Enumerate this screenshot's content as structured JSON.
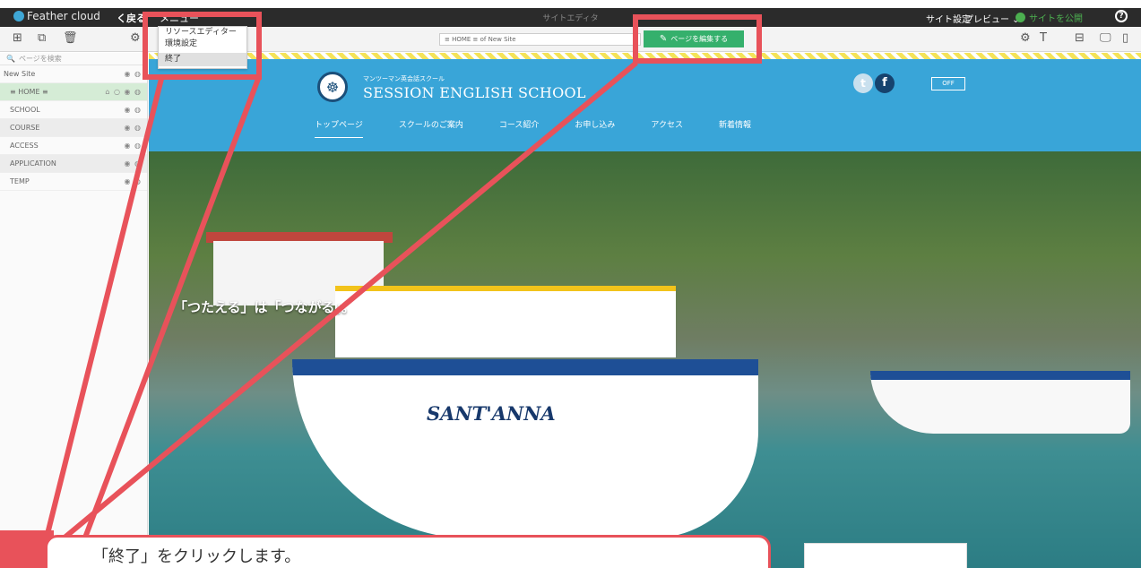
{
  "app": {
    "brand": "Feather cloud",
    "back_label": "く戻る",
    "menu_label": "メニュー",
    "title": "サイトエディタ",
    "site_settings": "サイト設定",
    "preview": "プレビュー ⌄",
    "publish": "サイトを公開",
    "help": "?"
  },
  "menu": {
    "items": [
      "リソースエディター",
      "環境設定",
      "終了"
    ]
  },
  "toolbar": {
    "url": "≡ HOME ≡ of New Site",
    "edit_button": "ページを編集する"
  },
  "sidebar": {
    "search_placeholder": "ページを検索",
    "items": [
      {
        "label": "New Site",
        "state": "root"
      },
      {
        "label": "≡ HOME ≡",
        "state": "selected"
      },
      {
        "label": "SCHOOL",
        "state": "normal"
      },
      {
        "label": "COURSE",
        "state": "shaded"
      },
      {
        "label": "ACCESS",
        "state": "normal"
      },
      {
        "label": "APPLICATION",
        "state": "shaded"
      },
      {
        "label": "TEMP",
        "state": "normal"
      }
    ]
  },
  "site": {
    "subtitle": "マンツーマン英会話スクール",
    "title": "SESSION ENGLISH SCHOOL",
    "lang_toggle": "OFF",
    "nav": [
      "トップページ",
      "スクールのご案内",
      "コース紹介",
      "お申し込み",
      "アクセス",
      "新着情報"
    ],
    "hero_text": "「つたえる」は「つながる」。",
    "boat_name": "SANT'ANNA"
  },
  "callout": {
    "text": "「終了」をクリックします。"
  },
  "colors": {
    "annotation": "#e8525a",
    "edit_button": "#35b06c",
    "site_blue": "#39a5d8"
  }
}
